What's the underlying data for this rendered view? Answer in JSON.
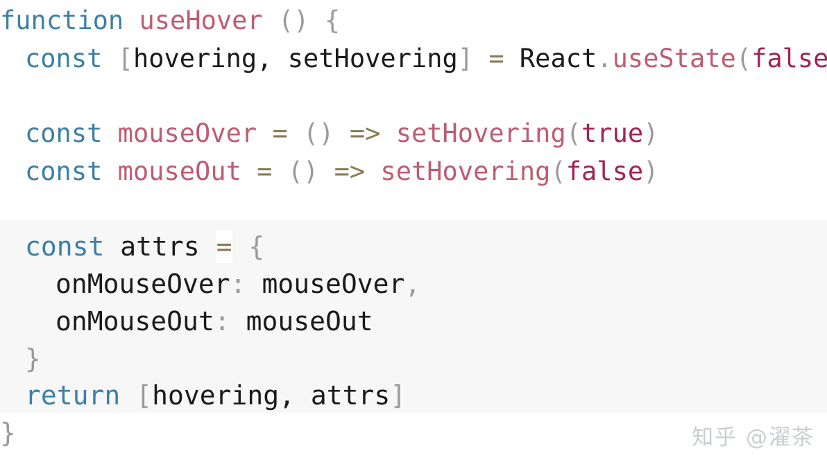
{
  "editor": {
    "language": "javascript",
    "background_color": "#ffffff",
    "highlight_band_color": "#f7f7f7",
    "theme_colors": {
      "keyword": "#3d7fa6",
      "function_name": "#bf5c72",
      "identifier": "#1a1a1a",
      "punctuation": "#9b9b9b",
      "operator": "#8a7b52",
      "boolean": "#a32256"
    }
  },
  "code": {
    "line1": {
      "kw_function": "function",
      "name": "useHover",
      "parens": "()",
      "brace_open": "{"
    },
    "line2": {
      "kw_const": "const",
      "bracket_open": "[",
      "var1": "hovering",
      "comma": ",",
      "var2": "setHovering",
      "bracket_close": "]",
      "equals": "=",
      "react": "React",
      "dot": ".",
      "use_state": "useState",
      "paren_open": "(",
      "bool_false": "false",
      "paren_close": ")"
    },
    "line3": {
      "kw_const": "const",
      "name": "mouseOver",
      "equals": "=",
      "arrow_params": "()",
      "arrow": "=>",
      "call": "setHovering",
      "paren_open": "(",
      "bool_true": "true",
      "paren_close": ")"
    },
    "line4": {
      "kw_const": "const",
      "name": "mouseOut",
      "equals": "=",
      "arrow_params": "()",
      "arrow": "=>",
      "call": "setHovering",
      "paren_open": "(",
      "bool_false": "false",
      "paren_close": ")"
    },
    "line5": {
      "kw_const": "const",
      "name": "attrs",
      "equals": "=",
      "brace_open": "{"
    },
    "line6": {
      "key": "onMouseOver",
      "colon": ":",
      "value": "mouseOver",
      "comma": ","
    },
    "line7": {
      "key": "onMouseOut",
      "colon": ":",
      "value": "mouseOut"
    },
    "line8": {
      "brace_close": "}"
    },
    "line9": {
      "kw_return": "return",
      "bracket_open": "[",
      "var1": "hovering",
      "comma": ",",
      "var2": "attrs",
      "bracket_close": "]"
    },
    "line10": {
      "brace_close": "}"
    }
  },
  "watermark": {
    "text": "知乎 @濯茶"
  }
}
